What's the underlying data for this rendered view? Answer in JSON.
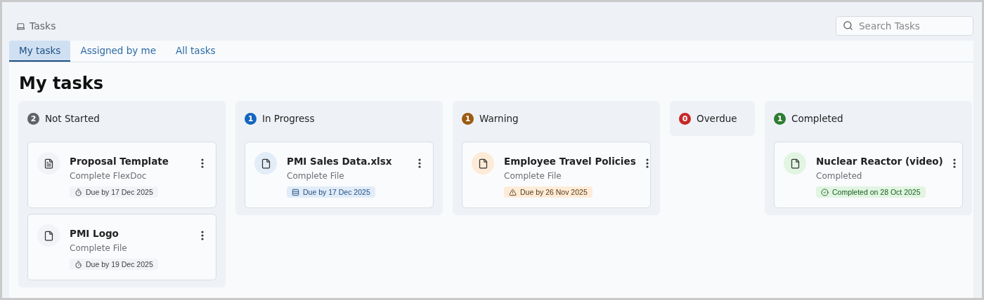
{
  "header": {
    "title": "Tasks",
    "search": {
      "placeholder": "Search Tasks"
    }
  },
  "tabs": [
    {
      "label": "My tasks",
      "selected": true
    },
    {
      "label": "Assigned by me",
      "selected": false
    },
    {
      "label": "All tasks",
      "selected": false
    }
  ],
  "heading": "My tasks",
  "columns": [
    {
      "title": "Not Started",
      "count": "2",
      "color": "#5f6368",
      "kind": "neutral",
      "tasks": [
        {
          "title": "Proposal Template",
          "subtitle": "Complete FlexDoc",
          "kind": "document",
          "chip": {
            "kind": "clock",
            "text": "Due by 17 Dec 2025"
          }
        },
        {
          "title": "PMI Logo",
          "subtitle": "Complete File",
          "kind": "file",
          "chip": {
            "kind": "clock",
            "text": "Due by 19 Dec 2025"
          }
        }
      ]
    },
    {
      "title": "In Progress",
      "count": "1",
      "color": "#1565c0",
      "kind": "info",
      "tasks": [
        {
          "title": "PMI Sales Data.xlsx",
          "subtitle": "Complete File",
          "kind": "file",
          "chip": {
            "kind": "calendar",
            "text": "Due by 17 Dec 2025"
          }
        }
      ]
    },
    {
      "title": "Warning",
      "count": "1",
      "color": "#9c5a12",
      "kind": "warning",
      "tasks": [
        {
          "title": "Employee Travel Policies",
          "subtitle": "Complete File",
          "kind": "file",
          "chip": {
            "kind": "warning",
            "text": "Due by 26 Nov 2025"
          }
        }
      ]
    },
    {
      "title": "Overdue",
      "count": "0",
      "color": "#c62828",
      "kind": "danger"
    },
    {
      "title": "Completed",
      "count": "1",
      "color": "#2e7d32",
      "kind": "success",
      "tasks": [
        {
          "title": "Nuclear Reactor (video)",
          "subtitle": "Completed",
          "kind": "file",
          "chip": {
            "kind": "check",
            "text": "Completed on 28 Oct 2025"
          }
        }
      ]
    }
  ]
}
